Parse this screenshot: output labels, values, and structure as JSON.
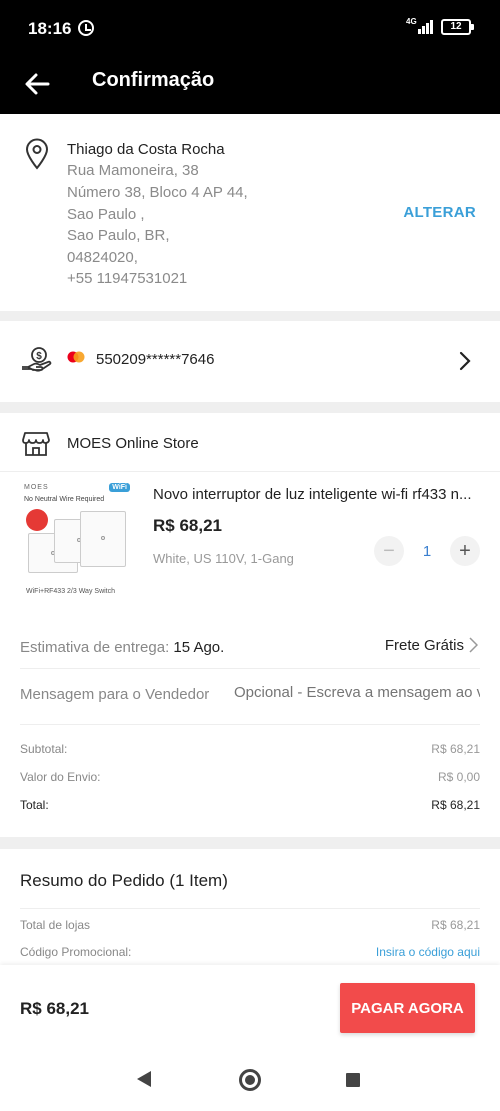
{
  "status": {
    "time": "18:16",
    "network": "4G",
    "battery": "12"
  },
  "header": {
    "title": "Confirmação"
  },
  "address": {
    "name": "Thiago da Costa Rocha",
    "lines": [
      "Rua Mamoneira, 38",
      "Número 38, Bloco 4 AP 44,",
      "Sao Paulo ,",
      "Sao Paulo, BR,",
      "04824020,",
      "+55 11947531021"
    ],
    "change_label": "ALTERAR"
  },
  "payment": {
    "card_number": "550209******7646"
  },
  "store": {
    "name": "MOES Online Store"
  },
  "product": {
    "image": {
      "brand": "MOES",
      "wifi_badge": "WiFi",
      "subtitle": "No Neutral Wire Required",
      "caption": "WiFi+RF433 2/3 Way Switch"
    },
    "title": "Novo interruptor de luz inteligente wi-fi rf433 n...",
    "price": "R$ 68,21",
    "variant": "White, US 110V, 1-Gang",
    "quantity": "1",
    "minus": "−",
    "plus": "+"
  },
  "shipping": {
    "label": "Estimativa de entrega:",
    "date": "15 Ago.",
    "cost_label": "Frete Grátis"
  },
  "message": {
    "label": "Mensagem para o Vendedor",
    "placeholder": "Opcional - Escreva a mensagem ao vendedor"
  },
  "summary": {
    "subtotal_label": "Subtotal:",
    "subtotal_value": "R$ 68,21",
    "shipping_label": "Valor do Envio:",
    "shipping_value": "R$ 0,00",
    "total_label": "Total:",
    "total_value": "R$ 68,21"
  },
  "resumo": {
    "title": "Resumo do Pedido (1 Item)",
    "stores_label": "Total de lojas",
    "stores_value": "R$ 68,21",
    "promo_label": "Código Promocional:",
    "promo_link": "Insira o código aqui"
  },
  "footer": {
    "price": "R$ 68,21",
    "pay_label": "PAGAR AGORA"
  },
  "colors": {
    "accent": "#3a9fd8",
    "pay_button": "#f24b4b",
    "header_bg": "#000000"
  }
}
